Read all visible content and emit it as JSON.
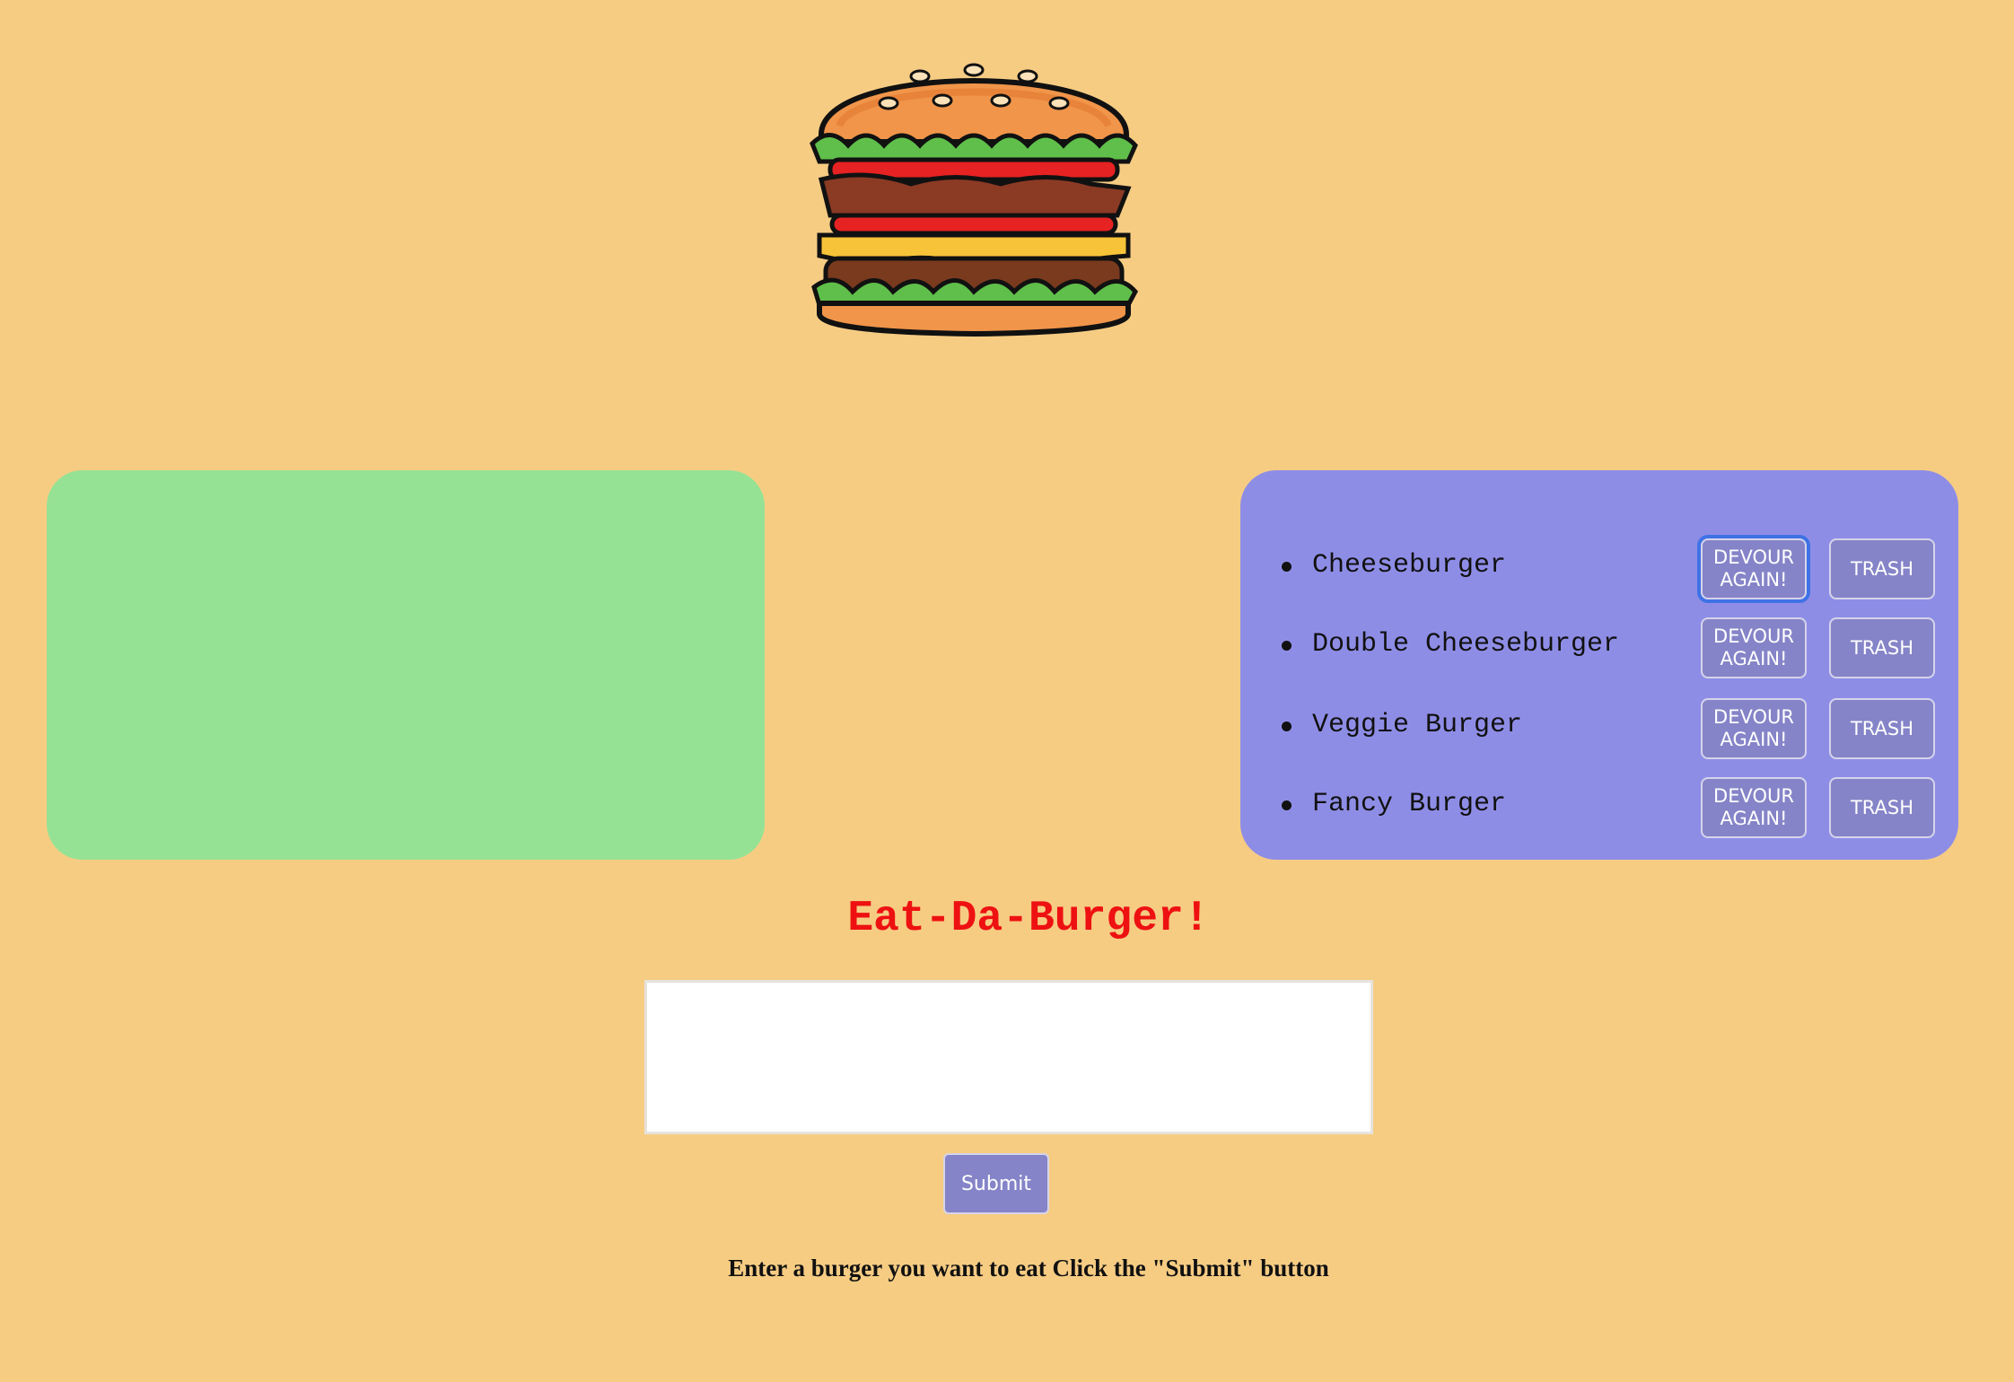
{
  "header": {
    "logo_icon": "burger-icon"
  },
  "devoured_panel": {
    "color": "#96e295",
    "items": []
  },
  "burger_panel": {
    "color": "#8e8de6",
    "items": [
      {
        "name": "Cheeseburger",
        "devour_label": "DEVOUR AGAIN!",
        "trash_label": "TRASH"
      },
      {
        "name": "Double Cheeseburger",
        "devour_label": "DEVOUR AGAIN!",
        "trash_label": "TRASH"
      },
      {
        "name": "Veggie Burger",
        "devour_label": "DEVOUR AGAIN!",
        "trash_label": "TRASH"
      },
      {
        "name": "Fancy Burger",
        "devour_label": "DEVOUR AGAIN!",
        "trash_label": "TRASH"
      }
    ]
  },
  "main": {
    "title": "Eat-Da-Burger!",
    "title_color": "#ee1111",
    "input_value": "",
    "submit_label": "Submit",
    "instructions": "Enter a burger you want to eat Click the \"Submit\" button"
  },
  "colors": {
    "background": "#f6cc83",
    "button": "#8584c8",
    "focus_ring": "#3f72e6"
  }
}
